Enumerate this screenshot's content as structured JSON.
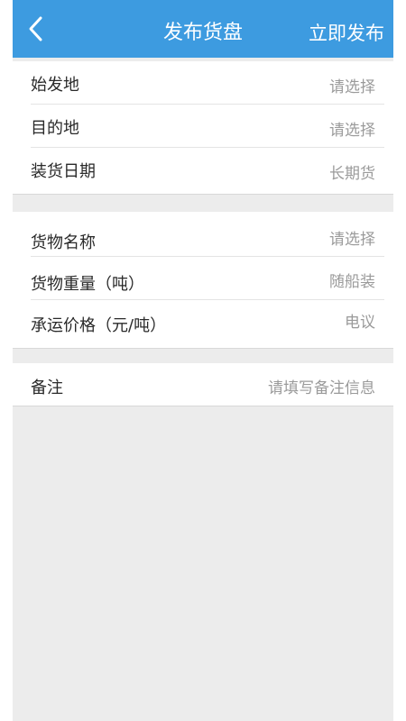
{
  "header": {
    "title": "发布货盘",
    "publish_label": "立即发布"
  },
  "group1": {
    "rows": [
      {
        "label": "始发地",
        "value": "请选择"
      },
      {
        "label": "目的地",
        "value": "请选择"
      },
      {
        "label": "装货日期",
        "value": "长期货"
      }
    ]
  },
  "group2": {
    "rows": [
      {
        "label": "货物名称",
        "value": "请选择"
      },
      {
        "label": "货物重量（吨）",
        "value": "随船装"
      },
      {
        "label": "承运价格（元/吨）",
        "value": "电议"
      }
    ]
  },
  "remark": {
    "label": "备注",
    "placeholder": "请填写备注信息"
  },
  "colors": {
    "header_bg": "#3d9be0",
    "page_bg": "#ececec",
    "label_text": "#2a2a2a",
    "value_text": "#9a9a9a"
  },
  "icons": {
    "back": "chevron-left-icon"
  }
}
